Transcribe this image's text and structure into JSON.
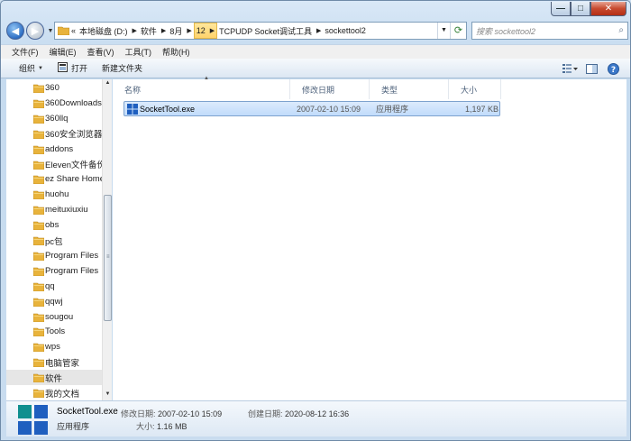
{
  "titlebar": {
    "minimize_glyph": "—",
    "maximize_glyph": "□",
    "close_glyph": "✕"
  },
  "navigation": {
    "back_glyph": "◀",
    "forward_glyph": "▶",
    "overflow_glyph": "«",
    "breadcrumbs": [
      "本地磁盘 (D:)",
      "软件",
      "8月",
      "12",
      "TCPUDP Socket调试工具",
      "sockettool2"
    ],
    "search_placeholder": "搜索 sockettool2"
  },
  "menu": [
    "文件(F)",
    "编辑(E)",
    "查看(V)",
    "工具(T)",
    "帮助(H)"
  ],
  "toolbar": {
    "organize": "组织",
    "open": "打开",
    "new_folder": "新建文件夹"
  },
  "tree": {
    "items": [
      "360",
      "360Downloads",
      "360llq",
      "360安全浏览器",
      "addons",
      "Eleven文件备份",
      "ez Share Home",
      "huohu",
      "meituxiuxiu",
      "obs",
      "pc包",
      "Program Files",
      "Program Files",
      "qq",
      "qqwj",
      "sougou",
      "Tools",
      "wps",
      "电脑管家",
      "软件",
      "我的文档"
    ],
    "selected_index": 19
  },
  "columns": [
    "名称",
    "修改日期",
    "类型",
    "大小"
  ],
  "files": [
    {
      "name": "SocketTool.exe",
      "modified": "2007-02-10 15:09",
      "type": "应用程序",
      "size": "1,197 KB"
    }
  ],
  "details": {
    "name": "SocketTool.exe",
    "type": "应用程序",
    "modified_label": "修改日期:",
    "modified": "2007-02-10 15:09",
    "size_label": "大小:",
    "size": "1.16 MB",
    "created_label": "创建日期:",
    "created": "2020-08-12 16:36"
  },
  "colors": {
    "folder": "#e8b33c",
    "selection": "#c1dcfb",
    "exe_blue": "#1f5fbf"
  }
}
